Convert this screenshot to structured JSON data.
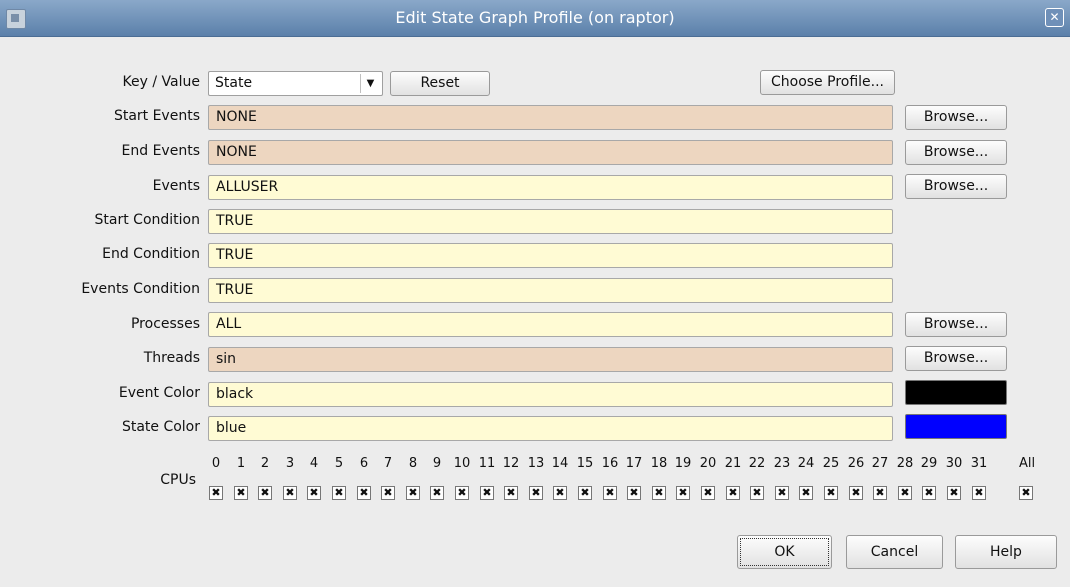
{
  "window": {
    "title": "Edit State Graph Profile (on raptor)"
  },
  "labels": {
    "key_value": "Key / Value",
    "start_events": "Start Events",
    "end_events": "End Events",
    "events": "Events",
    "start_condition": "Start Condition",
    "end_condition": "End Condition",
    "events_condition": "Events Condition",
    "processes": "Processes",
    "threads": "Threads",
    "event_color": "Event Color",
    "state_color": "State Color",
    "cpus": "CPUs"
  },
  "key_value": {
    "selected": "State"
  },
  "buttons": {
    "reset": "Reset",
    "choose_profile": "Choose Profile...",
    "browse": "Browse...",
    "ok": "OK",
    "cancel": "Cancel",
    "help": "Help"
  },
  "fields": {
    "start_events": "NONE",
    "end_events": "NONE",
    "events": "ALLUSER",
    "start_condition": "TRUE",
    "end_condition": "TRUE",
    "events_condition": "TRUE",
    "processes": "ALL",
    "threads": "sin",
    "event_color": "black",
    "state_color": "blue"
  },
  "colors": {
    "event_swatch": "#000000",
    "state_swatch": "#0000ff",
    "field_yellow": "#fffbd4",
    "field_tan": "#edd6c0"
  },
  "cpus": {
    "numbers": [
      "0",
      "1",
      "2",
      "3",
      "4",
      "5",
      "6",
      "7",
      "8",
      "9",
      "10",
      "11",
      "12",
      "13",
      "14",
      "15",
      "16",
      "17",
      "18",
      "19",
      "20",
      "21",
      "22",
      "23",
      "24",
      "25",
      "26",
      "27",
      "28",
      "29",
      "30",
      "31"
    ],
    "all_label": "All",
    "checked_mark": "✖"
  }
}
